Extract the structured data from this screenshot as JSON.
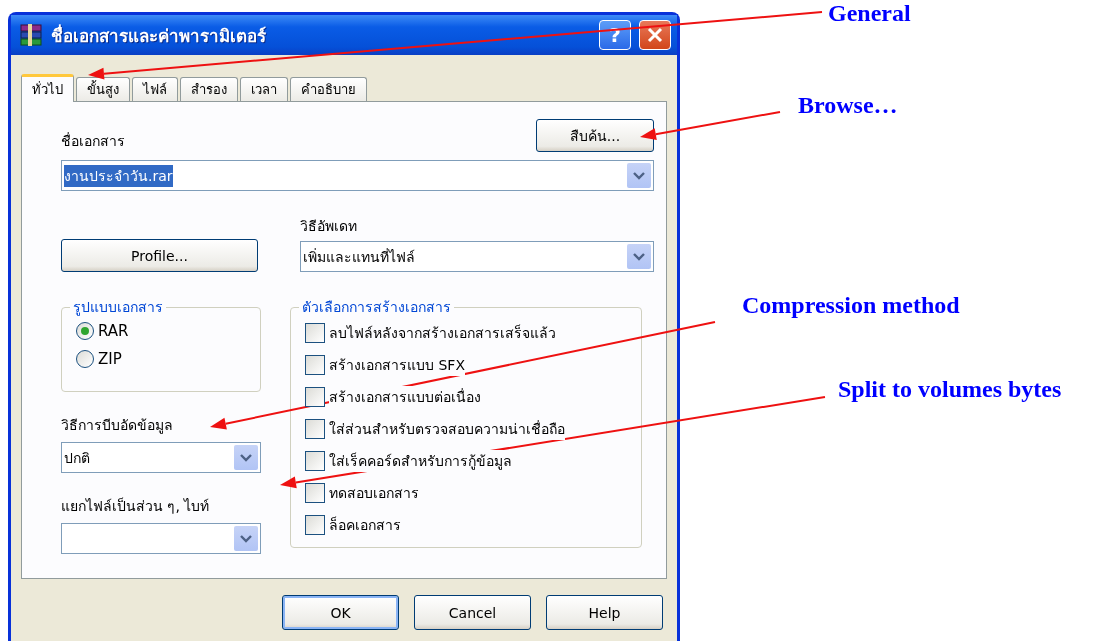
{
  "window": {
    "title": "ชื่อเอกสารและค่าพารามิเตอร์",
    "help_button": "?"
  },
  "tabs": [
    {
      "label": "ทั่วไป",
      "selected": true
    },
    {
      "label": "ขั้นสูง",
      "selected": false
    },
    {
      "label": "ไฟล์",
      "selected": false
    },
    {
      "label": "สำรอง",
      "selected": false
    },
    {
      "label": "เวลา",
      "selected": false
    },
    {
      "label": "คำอธิบาย",
      "selected": false
    }
  ],
  "archive_name": {
    "label": "ชื่อเอกสาร",
    "value": "งานประจำวัน.rar",
    "selected": true
  },
  "browse_button": "สืบค้น...",
  "profile_button": "Profile...",
  "update_method": {
    "label": "วิธีอัพเดท",
    "value": "เพิ่มและแทนที่ไฟล์"
  },
  "archive_format": {
    "label": "รูปแบบเอกสาร",
    "options": [
      {
        "label": "RAR",
        "selected": true
      },
      {
        "label": "ZIP",
        "selected": false
      }
    ]
  },
  "archive_options": {
    "label": "ตัวเลือกการสร้างเอกสาร",
    "options": [
      {
        "label": "ลบไฟล์หลังจากสร้างเอกสารเสร็จแล้ว",
        "checked": false
      },
      {
        "label": "สร้างเอกสารแบบ SFX",
        "checked": false
      },
      {
        "label": "สร้างเอกสารแบบต่อเนื่อง",
        "checked": false
      },
      {
        "label": "ใส่ส่วนสำหรับตรวจสอบความน่าเชื่อถือ",
        "checked": false
      },
      {
        "label": "ใส่เร็คคอร์ดสำหรับการกู้ข้อมูล",
        "checked": false
      },
      {
        "label": "ทดสอบเอกสาร",
        "checked": false
      },
      {
        "label": "ล็อคเอกสาร",
        "checked": false
      }
    ]
  },
  "compression_method": {
    "label": "วิธีการบีบอัดข้อมูล",
    "value": "ปกติ"
  },
  "split_volumes": {
    "label": "แยกไฟล์เป็นส่วน ๆ, ไบท์"
  },
  "buttons": [
    {
      "label": "OK",
      "default": true
    },
    {
      "label": "Cancel",
      "default": false
    },
    {
      "label": "Help",
      "default": false
    }
  ],
  "annotations": [
    {
      "text": "General"
    },
    {
      "text": "Browse…"
    },
    {
      "text": "Compression method"
    },
    {
      "text": "Split to volumes bytes"
    }
  ]
}
